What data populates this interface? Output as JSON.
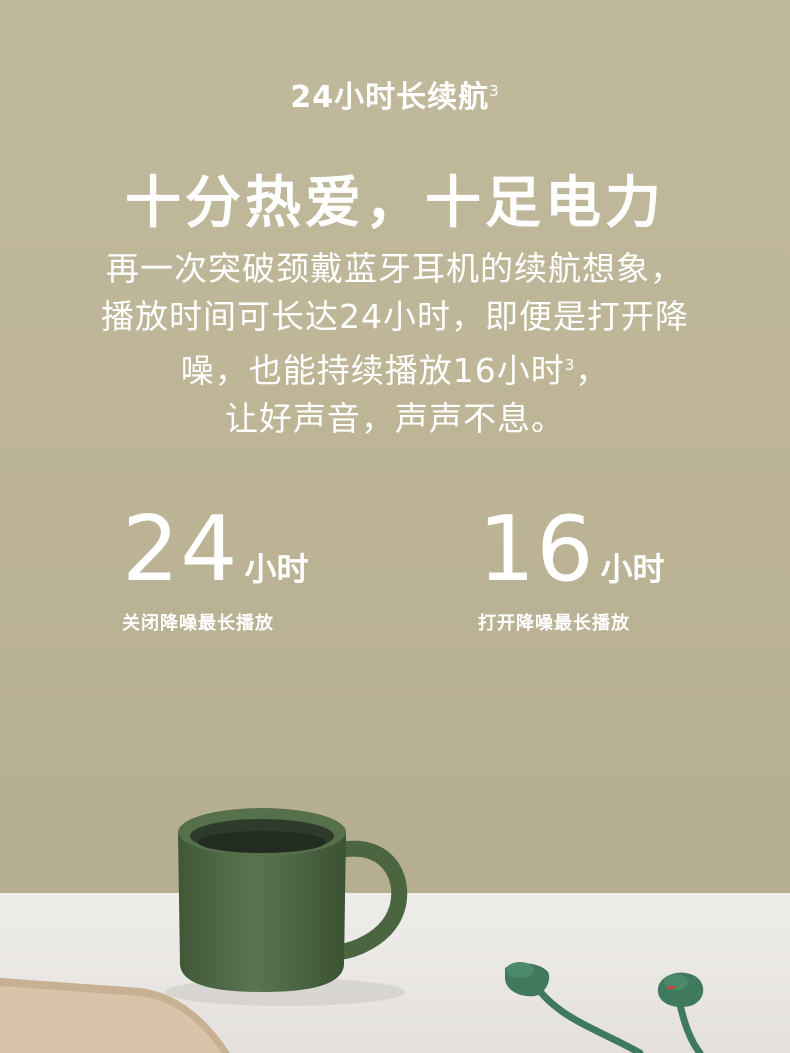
{
  "eyebrow": {
    "text": "24小时长续航",
    "footnote": "3"
  },
  "headline": "十分热爱，十足电力",
  "body": {
    "line1": "再一次突破颈戴蓝牙耳机的续航想象，",
    "line2": "播放时间可长达24小时，即便是打开降",
    "line3": "噪，也能持续播放16小时",
    "line3_footnote": "3",
    "line3_end": "，",
    "line4": "让好声音，声声不息。"
  },
  "stats": [
    {
      "value": "24",
      "unit": "小时",
      "caption": "关闭降噪最长播放"
    },
    {
      "value": "16",
      "unit": "小时",
      "caption": "打开降噪最长播放"
    }
  ],
  "colors": {
    "background": "#bdb596",
    "text": "#ffffff",
    "mug": "#4f6a44",
    "tabletop": "#ebe9e6",
    "earbuds": "#3f7a5e",
    "book": "#d8c3a8"
  }
}
